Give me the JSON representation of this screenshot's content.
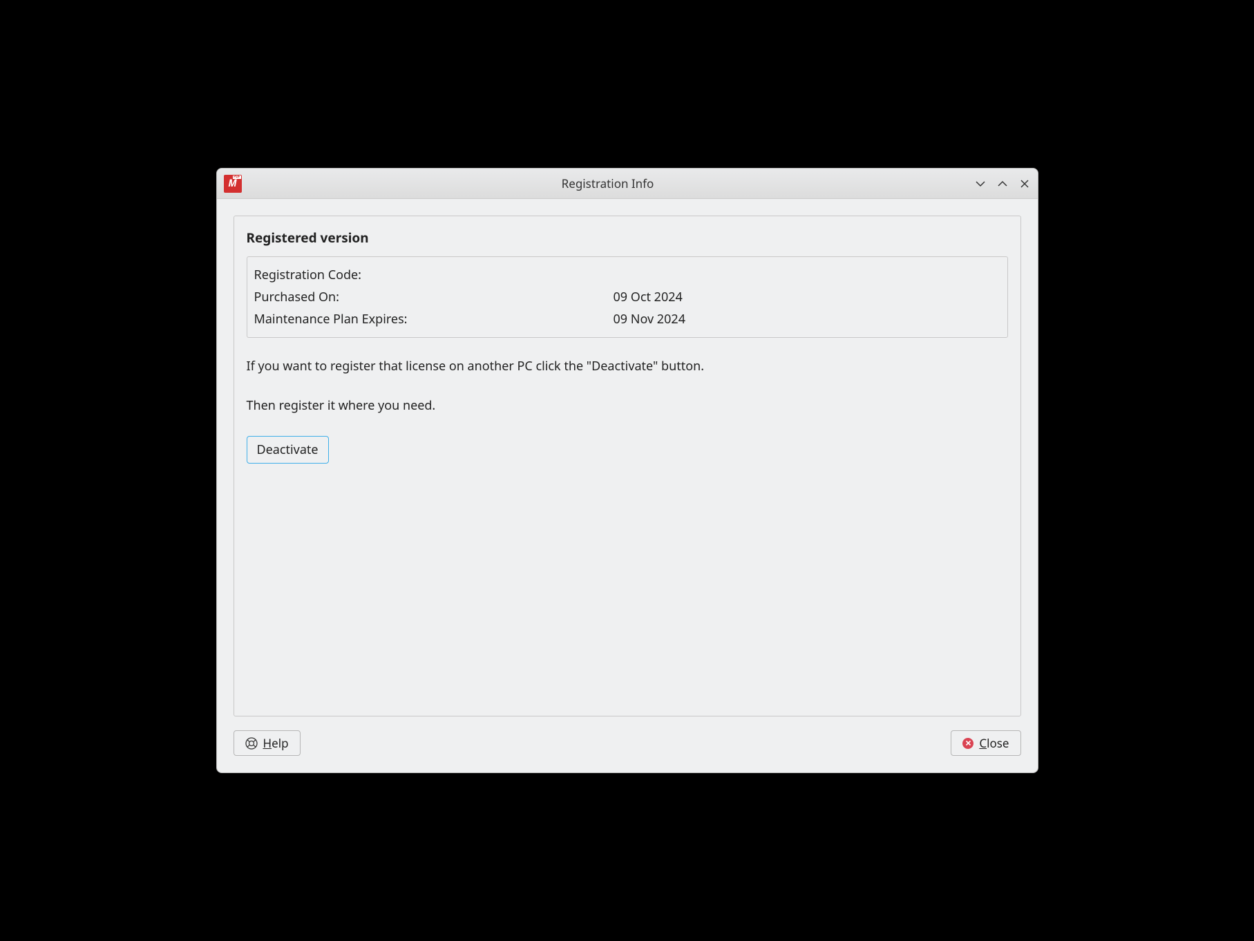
{
  "titlebar": {
    "title": "Registration Info",
    "app_icon_label": "PDF"
  },
  "content": {
    "section_title": "Registered version",
    "registration_code_label": "Registration Code:",
    "registration_code_value": "",
    "purchased_on_label": "Purchased On:",
    "purchased_on_value": "09 Oct 2024",
    "maintenance_expires_label": "Maintenance Plan Expires:",
    "maintenance_expires_value": "09 Nov 2024",
    "hint_line1": "If you want to register that license on another PC click the \"Deactivate\" button.",
    "hint_line2": "Then register it where you need.",
    "deactivate_label": "Deactivate"
  },
  "footer": {
    "help_label": "Help",
    "close_label": "Close"
  }
}
